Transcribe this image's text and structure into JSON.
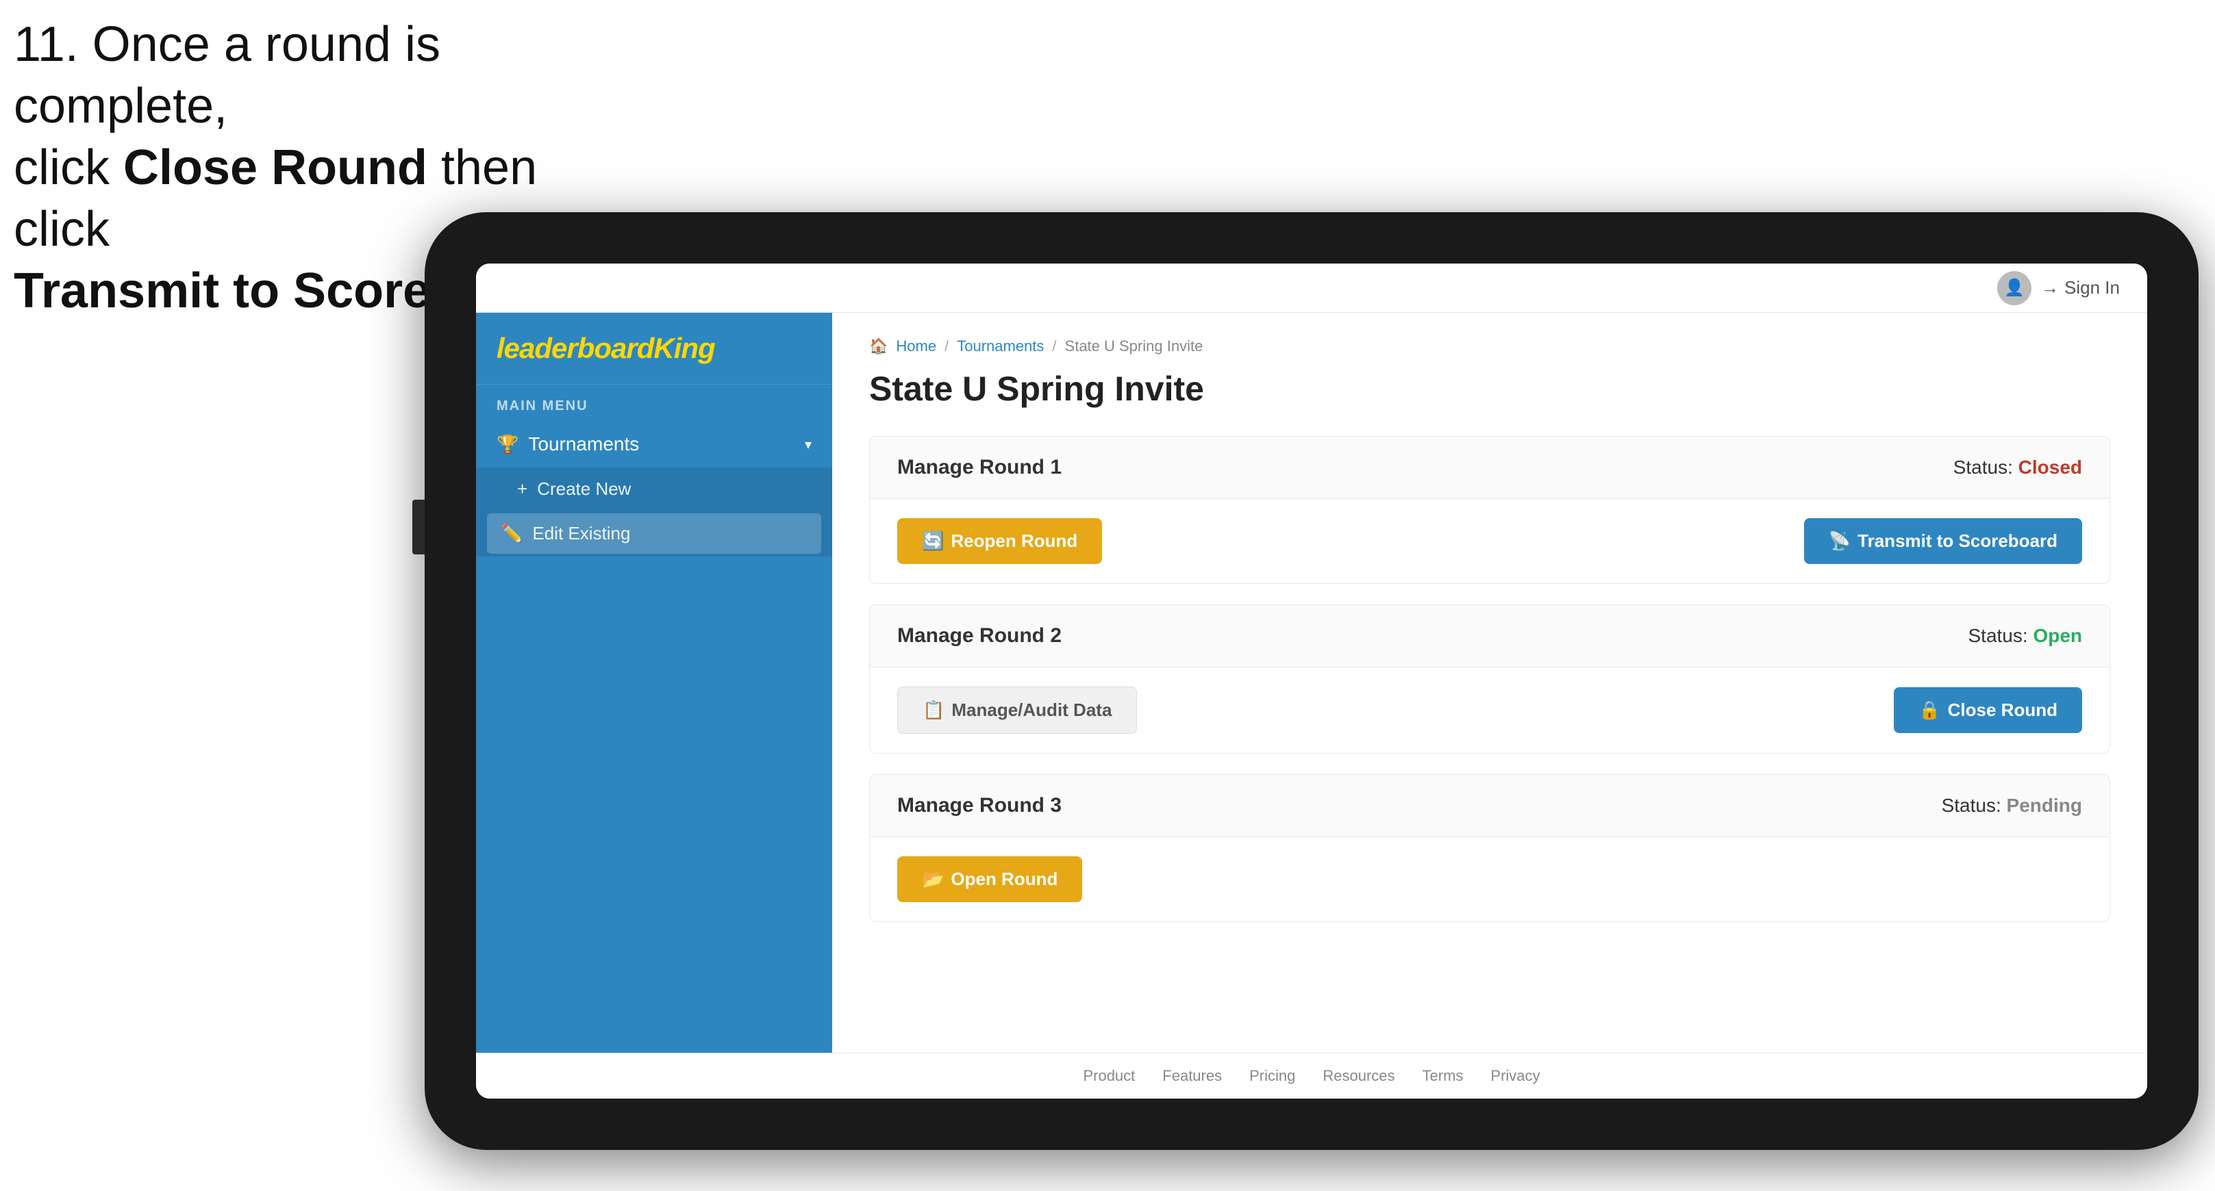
{
  "instruction": {
    "line1": "11. Once a round is complete,",
    "line2": "click ",
    "bold1": "Close Round",
    "line3": " then click",
    "bold2": "Transmit to Scoreboard."
  },
  "header": {
    "sign_in": "Sign In",
    "avatar_icon": "👤"
  },
  "logo": {
    "text_normal": "leaderboard",
    "text_styled": "King"
  },
  "sidebar": {
    "main_menu_label": "MAIN MENU",
    "tournaments_label": "Tournaments",
    "create_new_label": "Create New",
    "edit_existing_label": "Edit Existing"
  },
  "breadcrumb": {
    "home": "Home",
    "tournaments": "Tournaments",
    "current": "State U Spring Invite"
  },
  "page": {
    "title": "State U Spring Invite"
  },
  "rounds": [
    {
      "id": "round1",
      "title": "Manage Round 1",
      "status_label": "Status:",
      "status_value": "Closed",
      "status_type": "closed",
      "button1_label": "Reopen Round",
      "button1_type": "yellow",
      "button2_label": "Transmit to Scoreboard",
      "button2_type": "blue",
      "button1_icon": "🔄",
      "button2_icon": "📡"
    },
    {
      "id": "round2",
      "title": "Manage Round 2",
      "status_label": "Status:",
      "status_value": "Open",
      "status_type": "open",
      "button1_label": "Manage/Audit Data",
      "button1_type": "gray",
      "button2_label": "Close Round",
      "button2_type": "blue",
      "button1_icon": "📋",
      "button2_icon": "🔒"
    },
    {
      "id": "round3",
      "title": "Manage Round 3",
      "status_label": "Status:",
      "status_value": "Pending",
      "status_type": "pending",
      "button1_label": "Open Round",
      "button1_type": "yellow",
      "button1_icon": "📂"
    }
  ],
  "footer": {
    "links": [
      "Product",
      "Features",
      "Pricing",
      "Resources",
      "Terms",
      "Privacy"
    ]
  },
  "arrow": {
    "color": "#e8003c"
  }
}
